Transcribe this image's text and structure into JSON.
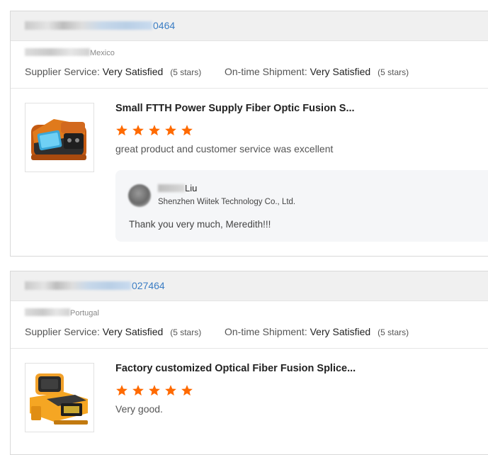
{
  "reviews": [
    {
      "order_suffix": "0464",
      "buyer_country": "Mexico",
      "supplier_service_label": "Supplier Service:",
      "supplier_service_value": "Very Satisfied",
      "supplier_service_stars": "(5 stars)",
      "shipment_label": "On-time Shipment:",
      "shipment_value": "Very Satisfied",
      "shipment_stars": "(5 stars)",
      "product_title": "Small FTTH Power Supply Fiber Optic Fusion S...",
      "rating": 5,
      "comment": "great product and customer service was excellent",
      "reply": {
        "name_suffix": "Liu",
        "company": "Shenzhen Wiitek Technology Co., Ltd.",
        "text": "Thank you very much, Meredith!!!"
      }
    },
    {
      "order_suffix": "027464",
      "buyer_country": "Portugal",
      "supplier_service_label": "Supplier Service:",
      "supplier_service_value": "Very Satisfied",
      "supplier_service_stars": "(5 stars)",
      "shipment_label": "On-time Shipment:",
      "shipment_value": "Very Satisfied",
      "shipment_stars": "(5 stars)",
      "product_title": "Factory customized Optical Fiber Fusion Splice...",
      "rating": 5,
      "comment": "Very good."
    }
  ],
  "colors": {
    "star": "#ff6a00",
    "link": "#3b7dc4"
  }
}
